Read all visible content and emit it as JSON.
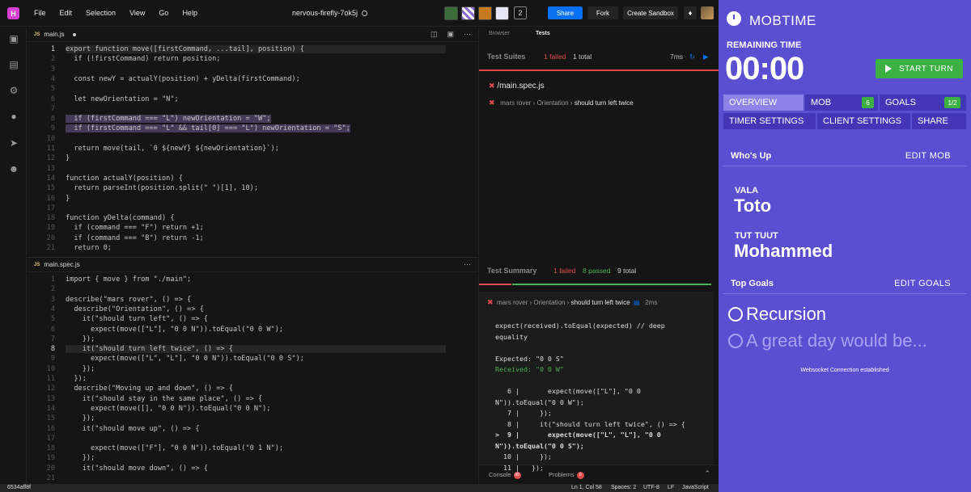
{
  "app": {
    "logo": "H",
    "title": "nervous-firefly-7ok5j"
  },
  "menu": [
    "File",
    "Edit",
    "Selection",
    "View",
    "Go",
    "Help"
  ],
  "header": {
    "collab_count": "2",
    "share": "Share",
    "fork": "Fork",
    "create_sandbox": "Create Sandbox"
  },
  "editor_top": {
    "tab": "main.js",
    "lines": [
      {
        "n": "1",
        "t": "export function move([firstCommand, ...tail], position) {"
      },
      {
        "n": "2",
        "t": "  if (!firstCommand) return position;"
      },
      {
        "n": "3",
        "t": ""
      },
      {
        "n": "4",
        "t": "  const newY = actualY(position) + yDelta(firstCommand);"
      },
      {
        "n": "5",
        "t": ""
      },
      {
        "n": "6",
        "t": "  let newOrientation = \"N\";"
      },
      {
        "n": "7",
        "t": ""
      },
      {
        "n": "8",
        "t": "  if (firstCommand === \"L\") newOrientation = \"W\";"
      },
      {
        "n": "9",
        "t": "  if (firstCommand === \"L\" && tail[0] === \"L\") newOrientation = \"S\";"
      },
      {
        "n": "10",
        "t": ""
      },
      {
        "n": "11",
        "t": "  return move(tail, `0 ${newY} ${newOrientation}`);"
      },
      {
        "n": "12",
        "t": "}"
      },
      {
        "n": "13",
        "t": ""
      },
      {
        "n": "14",
        "t": "function actualY(position) {"
      },
      {
        "n": "15",
        "t": "  return parseInt(position.split(\" \")[1], 10);"
      },
      {
        "n": "16",
        "t": "}"
      },
      {
        "n": "17",
        "t": ""
      },
      {
        "n": "18",
        "t": "function yDelta(command) {"
      },
      {
        "n": "19",
        "t": "  if (command === \"F\") return +1;"
      },
      {
        "n": "20",
        "t": "  if (command === \"B\") return -1;"
      },
      {
        "n": "21",
        "t": "  return 0;"
      }
    ]
  },
  "editor_bottom": {
    "tab": "main.spec.js",
    "lines": [
      {
        "n": "1",
        "t": "import { move } from \"./main\";"
      },
      {
        "n": "2",
        "t": ""
      },
      {
        "n": "3",
        "t": "describe(\"mars rover\", () => {"
      },
      {
        "n": "4",
        "t": "  describe(\"Orientation\", () => {"
      },
      {
        "n": "5",
        "t": "    it(\"should turn left\", () => {"
      },
      {
        "n": "6",
        "t": "      expect(move([\"L\"], \"0 0 N\")).toEqual(\"0 0 W\");"
      },
      {
        "n": "7",
        "t": "    });"
      },
      {
        "n": "8",
        "t": "    it(\"should turn left twice\", () => {"
      },
      {
        "n": "9",
        "t": "      expect(move([\"L\", \"L\"], \"0 0 N\")).toEqual(\"0 0 S\");"
      },
      {
        "n": "10",
        "t": "    });"
      },
      {
        "n": "11",
        "t": "  });"
      },
      {
        "n": "12",
        "t": "  describe(\"Moving up and down\", () => {"
      },
      {
        "n": "13",
        "t": "    it(\"should stay in the same place\", () => {"
      },
      {
        "n": "14",
        "t": "      expect(move([], \"0 0 N\")).toEqual(\"0 0 N\");"
      },
      {
        "n": "15",
        "t": "    });"
      },
      {
        "n": "16",
        "t": "    it(\"should move up\", () => {"
      },
      {
        "n": "17",
        "t": ""
      },
      {
        "n": "18",
        "t": "      expect(move([\"F\"], \"0 0 N\")).toEqual(\"0 1 N\");"
      },
      {
        "n": "19",
        "t": "    });"
      },
      {
        "n": "20",
        "t": "    it(\"should move down\", () => {"
      },
      {
        "n": "21",
        "t": ""
      }
    ]
  },
  "tests_panel": {
    "tabs": [
      "Browser",
      "Tests"
    ],
    "suites_label": "Test Suites",
    "suites_failed": "1 failed",
    "suites_total": "1 total",
    "duration": "7ms",
    "file": "/main.spec.js",
    "crumb": [
      "mars rover",
      "Orientation",
      "should turn left twice"
    ],
    "summary_label": "Test Summary",
    "summary_failed": "1 failed",
    "summary_passed": "8 passed",
    "summary_total": "9 total",
    "err_crumb": [
      "mars rover",
      "Orientation",
      "should turn left twice"
    ],
    "err_time": "2ms",
    "error_lines": [
      "expect(received).toEqual(expected) // deep",
      "equality",
      "",
      "Expected: \"0 0 S\"",
      "Received: \"0 0 W\"",
      "",
      "   6 |       expect(move([\"L\"], \"0 0",
      "N\")).toEqual(\"0 0 W\");",
      "   7 |     });",
      "   8 |     it(\"should turn left twice\", () => {",
      ">  9 |       expect(move([\"L\", \"L\"], \"0 0",
      "N\")).toEqual(\"0 0 S\");",
      "  10 |     });",
      "  11 |   });"
    ],
    "console_label": "Console",
    "console_count": "99",
    "problems_label": "Problems",
    "problems_count": "0"
  },
  "statusbar": {
    "hash": "6534aff8f",
    "position": "Ln 1, Col 58",
    "spaces": "Spaces: 2",
    "encoding": "UTF-8",
    "eol": "LF",
    "lang": "JavaScript"
  },
  "mobtime": {
    "title": "MOBTIME",
    "remaining_label": "REMAINING TIME",
    "timer": "00:00",
    "start_turn": "START TURN",
    "tabs": {
      "overview": "OVERVIEW",
      "mob": "MOB",
      "mob_count": "6",
      "goals": "GOALS",
      "goals_count": "1/2",
      "timer_settings": "TIMER SETTINGS",
      "client_settings": "CLIENT SETTINGS",
      "share": "SHARE"
    },
    "whos_up": "Who's Up",
    "edit_mob": "EDIT MOB",
    "members": [
      {
        "role": "VALA",
        "name": "Toto"
      },
      {
        "role": "TUT TUUT",
        "name": "Mohammed"
      }
    ],
    "top_goals": "Top Goals",
    "edit_goals": "EDIT GOALS",
    "goals": [
      "Recursion",
      "A great day would be..."
    ],
    "websocket": "Websocket Connection established"
  }
}
